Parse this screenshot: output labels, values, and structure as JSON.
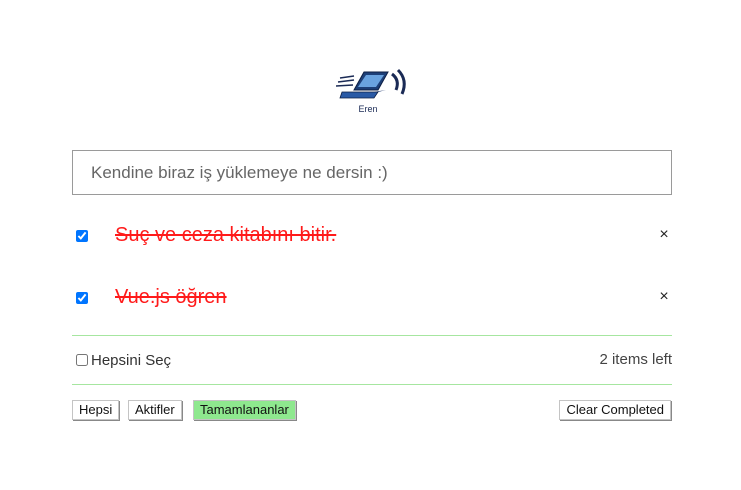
{
  "logo": {
    "text": "Eren",
    "icon": "laptop-icon"
  },
  "input": {
    "placeholder": "Kendine biraz iş yüklemeye ne dersin :)",
    "value": ""
  },
  "todos": [
    {
      "title": "Suç ve ceza kitabını bitir.",
      "completed": true,
      "remove": "×"
    },
    {
      "title": "Vue.js öğren",
      "completed": true,
      "remove": "×"
    }
  ],
  "footer": {
    "select_all_label": "Hepsini Seç",
    "select_all_checked": false,
    "items_left": "2 items left"
  },
  "filters": {
    "all": "Hepsi",
    "active": "Aktifler",
    "completed": "Tamamlananlar",
    "selected": "completed"
  },
  "clear_completed": "Clear Completed",
  "colors": {
    "completed_text": "#ff1a1a",
    "divider": "#a6e6a0",
    "active_filter": "#8ee88e"
  }
}
